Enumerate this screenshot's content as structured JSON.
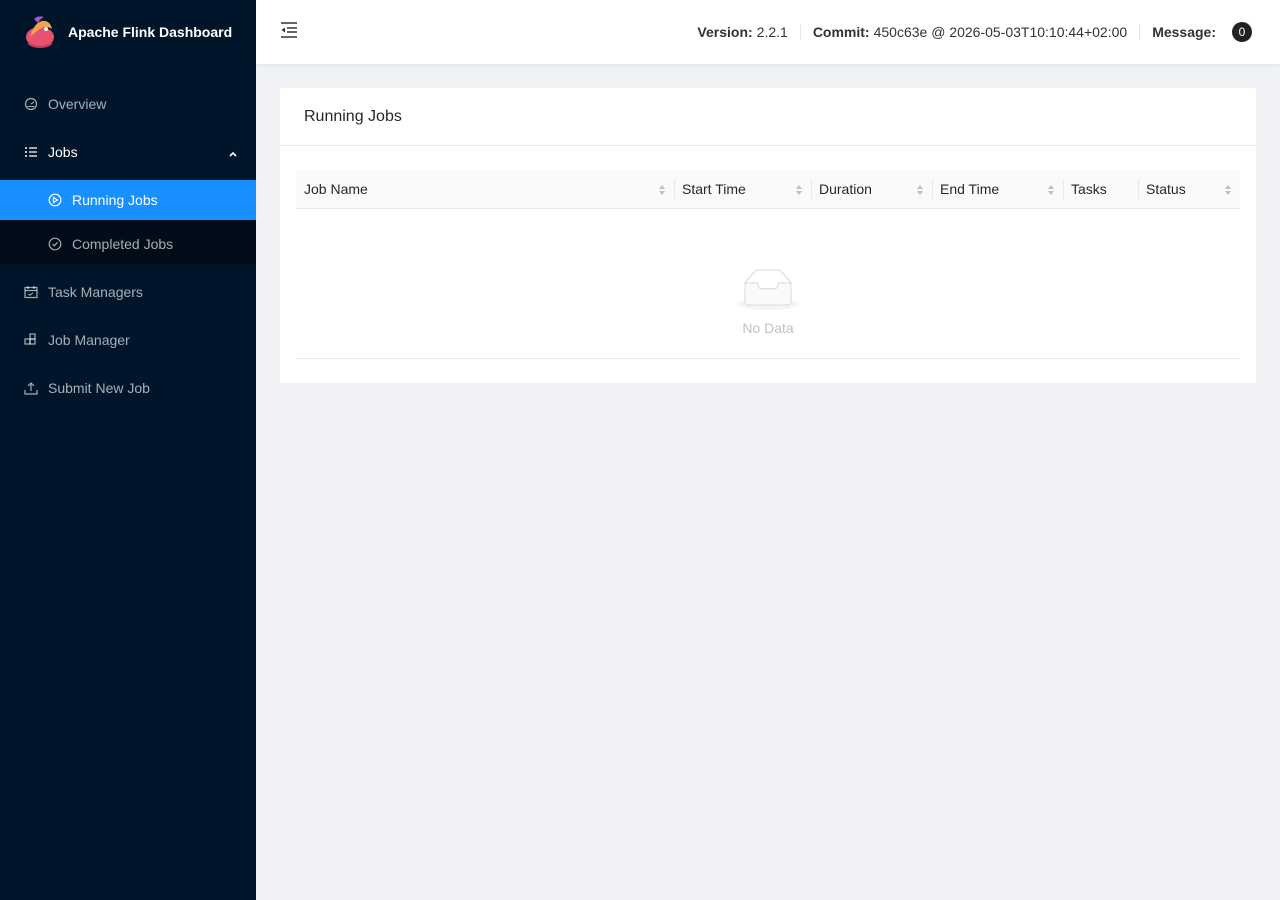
{
  "app": {
    "title": "Apache Flink Dashboard"
  },
  "sidebar": {
    "items": [
      {
        "label": "Overview",
        "icon": "dashboard-icon"
      },
      {
        "label": "Jobs",
        "icon": "list-icon",
        "expanded": true,
        "children": [
          {
            "label": "Running Jobs",
            "icon": "play-circle-icon",
            "active": true
          },
          {
            "label": "Completed Jobs",
            "icon": "check-circle-icon",
            "active": false
          }
        ]
      },
      {
        "label": "Task Managers",
        "icon": "schedule-icon"
      },
      {
        "label": "Job Manager",
        "icon": "build-icon"
      },
      {
        "label": "Submit New Job",
        "icon": "upload-icon"
      }
    ]
  },
  "header": {
    "version_label": "Version:",
    "version_value": "2.2.1",
    "commit_label": "Commit:",
    "commit_value": "450c63e @ 2026-05-03T10:10:44+02:00",
    "message_label": "Message:",
    "message_count": "0"
  },
  "main": {
    "card_title": "Running Jobs",
    "table": {
      "columns": [
        "Job Name",
        "Start Time",
        "Duration",
        "End Time",
        "Tasks",
        "Status"
      ],
      "rows": [],
      "empty_text": "No Data"
    }
  },
  "colors": {
    "sidebar_bg": "#001529",
    "submenu_bg": "#000c17",
    "accent": "#1890ff"
  }
}
